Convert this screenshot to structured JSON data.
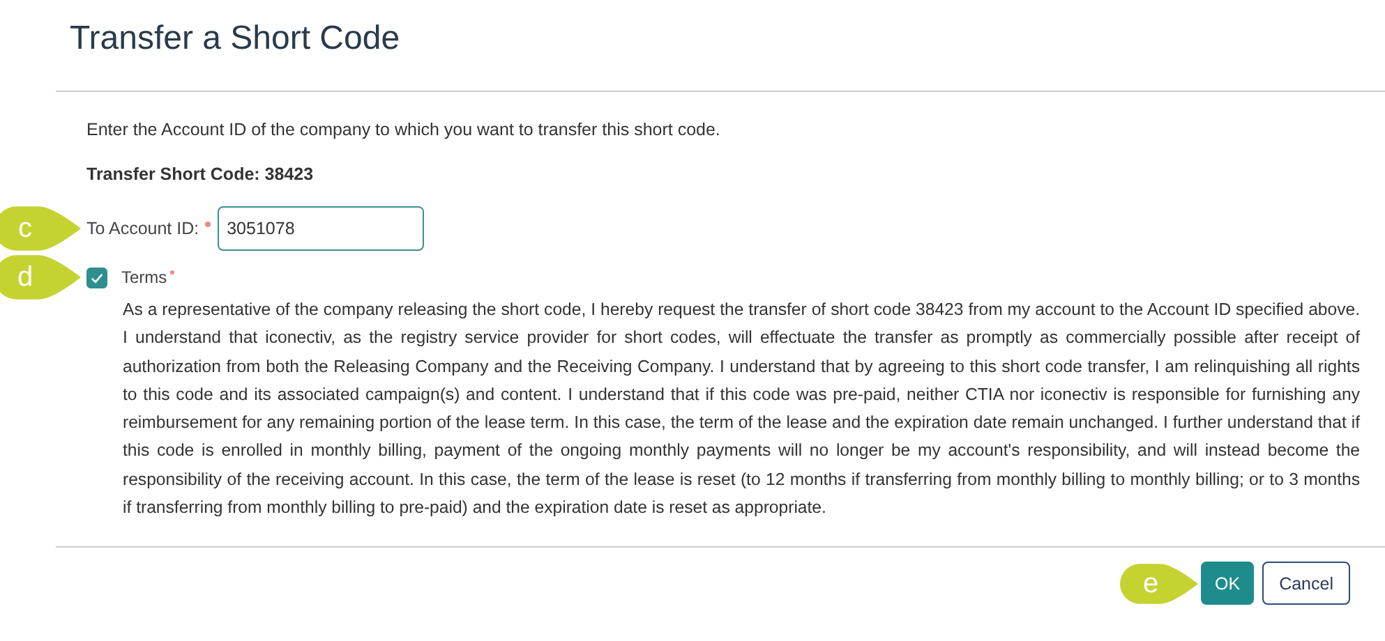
{
  "dialog": {
    "title": "Transfer a Short Code",
    "intro": "Enter the Account ID of the company to which you want to transfer this short code.",
    "short_code_label": "Transfer Short Code: 38423",
    "account_field": {
      "label": "To Account ID:",
      "required": true,
      "value": "3051078",
      "callout": "c"
    },
    "terms": {
      "label": "Terms",
      "required": true,
      "checked": true,
      "callout": "d",
      "text": "As a representative of the company releasing the short code, I hereby request the transfer of short code 38423 from my account to the Account ID specified above. I understand that iconectiv, as the registry service provider for short codes, will effectuate the transfer as promptly as commercially possible after receipt of authorization from both the Releasing Company and the Receiving Company. I understand that by agreeing to this short code transfer, I am relinquishing all rights to this code and its associated campaign(s) and content. I understand that if this code was pre-paid, neither CTIA nor iconectiv is responsible for furnishing any reimbursement for any remaining portion of the lease term. In this case, the term of the lease and the expiration date remain unchanged. I further understand that if this code is enrolled in monthly billing, payment of the ongoing monthly payments will no longer be my account's responsibility, and will instead become the responsibility of the receiving account. In this case, the term of the lease is reset (to 12 months if transferring from monthly billing to monthly billing; or to 3 months if transferring from monthly billing to pre-paid) and the expiration date is reset as appropriate."
    },
    "buttons": [
      {
        "label": "OK",
        "kind": "primary",
        "callout": "e"
      },
      {
        "label": "Cancel",
        "kind": "secondary"
      }
    ]
  }
}
